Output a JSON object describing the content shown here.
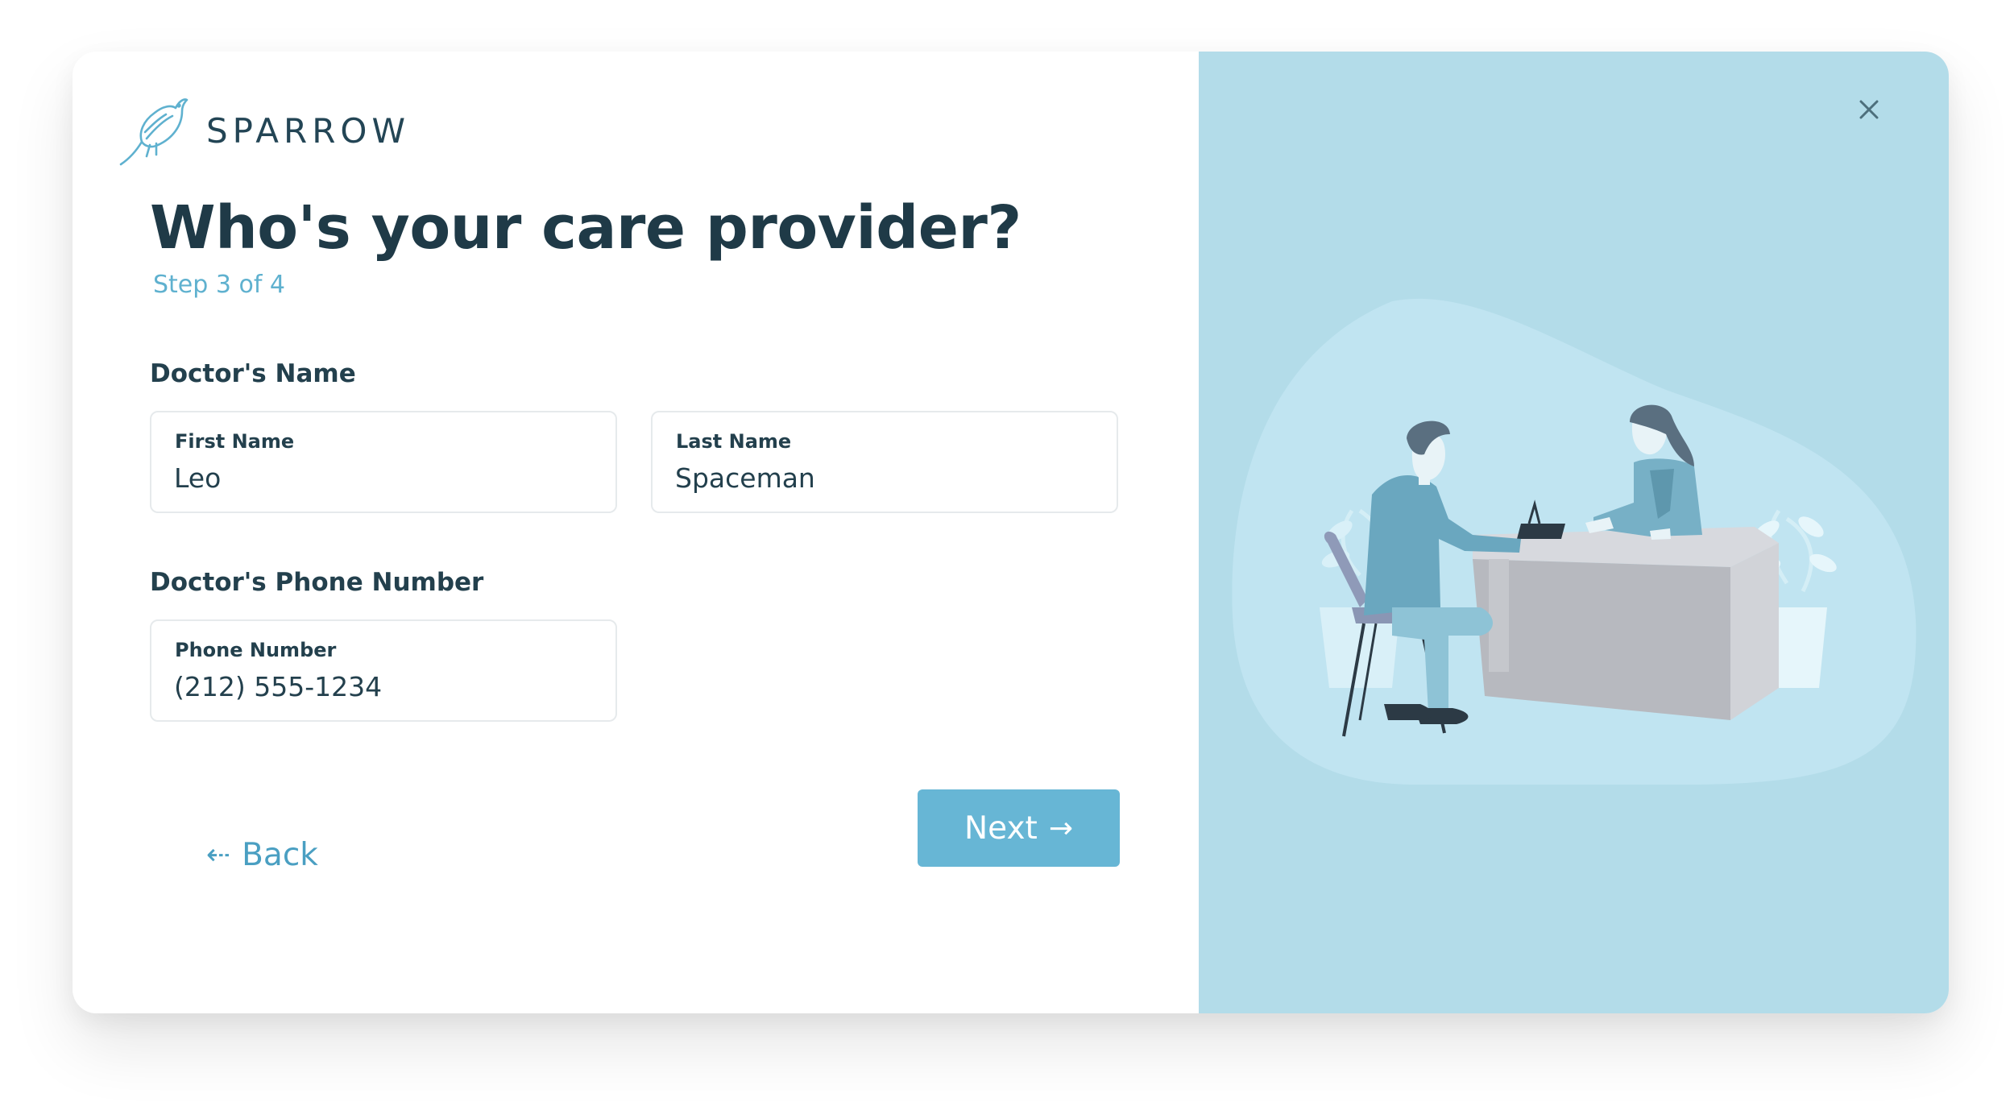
{
  "brand": {
    "name": "SPARROW",
    "logo_icon": "sparrow-bird-icon",
    "accent_color": "#5fb1cf"
  },
  "form": {
    "title": "Who's your care provider?",
    "step": "Step 3 of 4",
    "doctor_name_section": "Doctor's Name",
    "first_name": {
      "label": "First Name",
      "value": "Leo"
    },
    "last_name": {
      "label": "Last Name",
      "value": "Spaceman"
    },
    "phone_section": "Doctor's Phone Number",
    "phone": {
      "label": "Phone Number",
      "value": "(212) 555-1234"
    }
  },
  "actions": {
    "back_label": "Back",
    "back_icon": "arrow-left-icon",
    "next_label": "Next",
    "next_icon": "arrow-right-icon",
    "close_icon": "close-icon",
    "button_color": "#67b6d5"
  },
  "illustration": {
    "panel_color": "#b3dce9",
    "subject": "doctor-patient-consultation-illustration"
  }
}
